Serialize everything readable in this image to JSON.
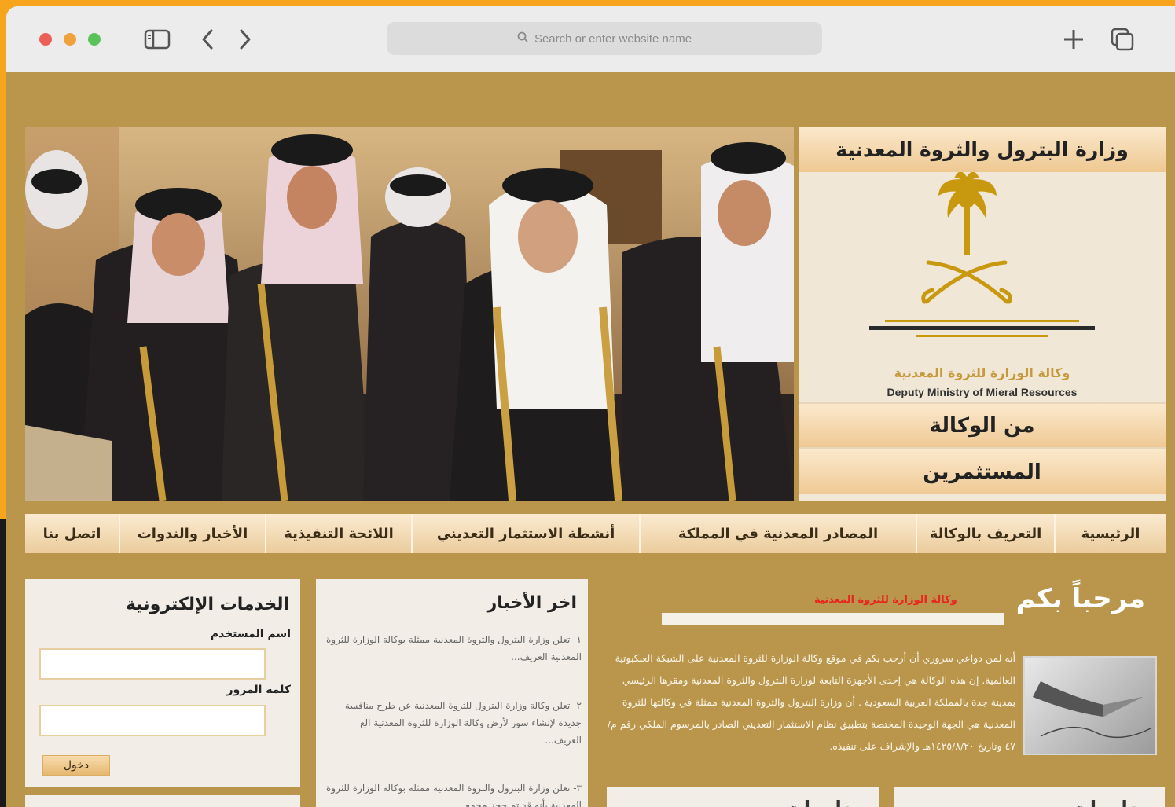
{
  "browser": {
    "address_placeholder": "Search or enter website name"
  },
  "ministry_box": {
    "title": "وزارة البترول والثروة المعدنية",
    "logo_caption_ar": "وكالة الوزارة للثروة المعدنية",
    "logo_caption_en": "Deputy Ministry of Mieral Resources",
    "link_agency": "من الوكالة",
    "link_investors": "المستثمرين"
  },
  "nav": {
    "items": [
      {
        "label": "الرئيسية"
      },
      {
        "label": "التعريف بالوكالة"
      },
      {
        "label": "المصادر المعدنية في المملكة"
      },
      {
        "label": "أنشطة الاستثمار التعديني"
      },
      {
        "label": "اللائحة التنفيذية"
      },
      {
        "label": "الأخبار والندوات"
      },
      {
        "label": "اتصل بنا"
      }
    ]
  },
  "eservices": {
    "title": "الخدمات الإلكترونية",
    "username_label": "اسم المستخدم",
    "password_label": "كلمة المرور",
    "login_button": "دخول"
  },
  "news": {
    "title": "اخر الأخبار",
    "items": [
      "١- تعلن وزارة البترول والثروة المعدنية ممثلة بوكالة الوزارة للثروة المعدنية العريف...",
      "٢- تعلن وكالة وزارة البترول للثروة المعدنية عن طرح منافسة جديدة لإنشاء سور لأرض وكالة الوزارة للثروة المعدنية الع العريف...",
      "٣- تعلن وزارة البترول والثروة المعدنية ممثلة بوكالة الوزارة للثروة المعدنية بأنه قد تم حجز مجمع"
    ]
  },
  "welcome": {
    "title": "مرحباً بكم",
    "subtitle": "وكالة الوزارة للثروة المعدنية",
    "body": "أنه لمن دواعي سروري أن أرحب بكم في موقع وكالة الوزارة للثروة المعدنية على الشبكة العنكبوتية العالمية. إن هذه الوكالة هي إحدى الأجهزة التابعة لوزارة البترول والثروة المعدنية ومقرها الرئيسي بمدينة جدة بالمملكة العربية السعودية . أن وزارة البترول والثروة المعدنية ممثلة في وكالتها للثروة المعدنية هي الجهة الوحيدة المختصة بتطبيق نظام الاستثمار التعديني الصادر بالمرسوم الملكي رقم م/٤٧ وتاريخ ١٤٢٥/٨/٢٠هـ والإشراف على تنفيذه."
  },
  "info_boxes": {
    "left": "معلومات",
    "right": "معلومات"
  }
}
